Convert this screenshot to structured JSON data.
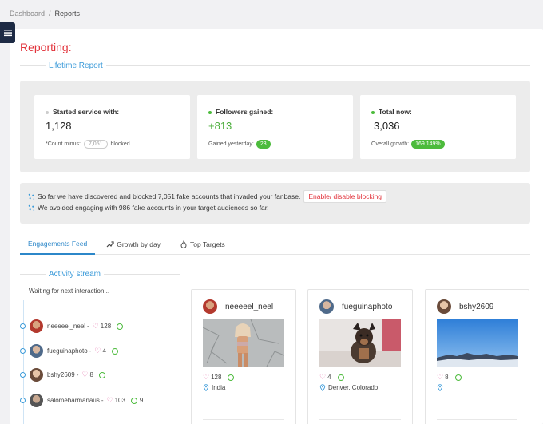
{
  "breadcrumb": {
    "items": [
      "Dashboard",
      "Reports"
    ]
  },
  "page": {
    "title": "Reporting:"
  },
  "lifetime": {
    "heading": "Lifetime Report",
    "started": {
      "label": "Started service with:",
      "value": "1,128",
      "sub_prefix": "*Count minus:",
      "sub_count": "7,051",
      "sub_suffix": "blocked",
      "dot_color": "#cccccc"
    },
    "gained": {
      "label": "Followers gained:",
      "value": "+813",
      "sub_label": "Gained yesterday:",
      "sub_value": "23",
      "dot_color": "#4cbb3c"
    },
    "total": {
      "label": "Total now:",
      "value": "3,036",
      "sub_label": "Overall growth:",
      "sub_value": "169.149%",
      "dot_color": "#4cbb3c"
    }
  },
  "info": {
    "line1": "So far we have discovered and blocked 7,051 fake accounts that invaded your fanbase.",
    "button": "Enable/ disable blocking",
    "line2": "We avoided engaging with 986 fake accounts in your target audiences so far."
  },
  "tabs": [
    {
      "label": "Engagements Feed",
      "icon": "none",
      "active": true
    },
    {
      "label": "Growth by day",
      "icon": "trend-icon"
    },
    {
      "label": "Top Targets",
      "icon": "flame-icon"
    }
  ],
  "activity": {
    "heading": "Activity stream",
    "waiting": "Waiting for next interaction...",
    "items": [
      {
        "name": "neeeeel_neel",
        "likes": "128",
        "comments": ""
      },
      {
        "name": "fueguinaphoto",
        "likes": "4",
        "comments": ""
      },
      {
        "name": "bshy2609",
        "likes": "8",
        "comments": ""
      },
      {
        "name": "salomebarmanaus",
        "likes": "103",
        "comments": "9"
      }
    ]
  },
  "profiles": [
    {
      "name": "neeeeel_neel",
      "likes": "128",
      "location": "India"
    },
    {
      "name": "fueguinaphoto",
      "likes": "4",
      "location": "Denver, Colorado"
    },
    {
      "name": "bshy2609",
      "likes": "8",
      "location": ""
    }
  ],
  "colors": {
    "accent": "#e2343c",
    "link": "#3a9ad9",
    "green": "#4cbb3c",
    "sidebar": "#1d2a44"
  }
}
